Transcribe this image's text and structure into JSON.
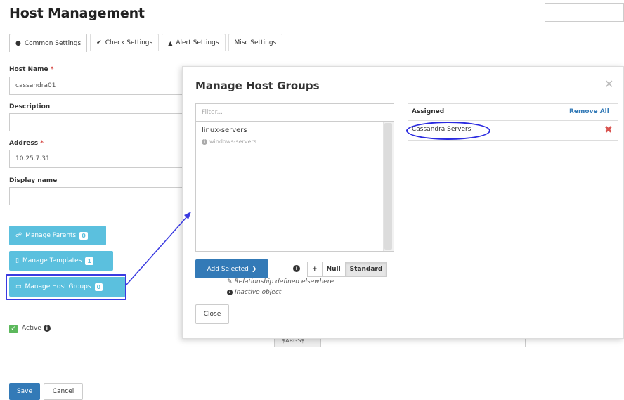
{
  "page": {
    "title": "Host Management"
  },
  "tabs": [
    {
      "label": "Common Settings",
      "icon": "circle-icon",
      "glyph": "●"
    },
    {
      "label": "Check Settings",
      "icon": "check-icon",
      "glyph": "✔"
    },
    {
      "label": "Alert Settings",
      "icon": "bell-icon",
      "glyph": "🔔"
    },
    {
      "label": "Misc Settings",
      "icon": "",
      "glyph": ""
    }
  ],
  "form": {
    "host_name": {
      "label": "Host Name",
      "required_mark": "*",
      "value": "cassandra01"
    },
    "description": {
      "label": "Description",
      "value": ""
    },
    "address": {
      "label": "Address",
      "required_mark": "*",
      "value": "10.25.7.31"
    },
    "display_name": {
      "label": "Display name",
      "value": ""
    }
  },
  "side_buttons": {
    "parents": {
      "label": "Manage Parents",
      "count": "0",
      "icon": "sitemap-icon",
      "glyph": "⚗"
    },
    "templates": {
      "label": "Manage Templates",
      "count": "1",
      "icon": "file-icon",
      "glyph": "🗋"
    },
    "host_groups": {
      "label": "Manage Host Groups",
      "count": "0",
      "icon": "folder-icon",
      "glyph": "🗁"
    }
  },
  "active": {
    "label": "Active",
    "checked_glyph": "✓",
    "info_glyph": "i"
  },
  "behind_addon": "$ARGS$",
  "footer": {
    "save_label": "Save",
    "cancel_label": "Cancel"
  },
  "modal": {
    "title": "Manage Host Groups",
    "close_glyph": "✕",
    "filter_placeholder": "Filter...",
    "available": [
      {
        "label": "linux-servers"
      },
      {
        "label": "windows-servers",
        "info_glyph": "i"
      }
    ],
    "add_selected_label": "Add Selected",
    "add_selected_glyph": "❯",
    "toggle": {
      "plus": "+",
      "null": "Null",
      "standard": "Standard",
      "selected": "Standard"
    },
    "legend": {
      "relationship": "Relationship defined elsewhere",
      "relationship_glyph": "✎",
      "inactive": "Inactive object",
      "inactive_glyph": "i"
    },
    "close_label": "Close",
    "assigned": {
      "header": "Assigned",
      "remove_all": "Remove All",
      "items": [
        {
          "label": "Cassandra Servers",
          "remove_glyph": "✖"
        }
      ]
    }
  },
  "colors": {
    "primary": "#337ab7",
    "info": "#5bc0de",
    "success": "#5cb85c",
    "danger": "#d9534f",
    "annotation": "#2a2ae0"
  }
}
